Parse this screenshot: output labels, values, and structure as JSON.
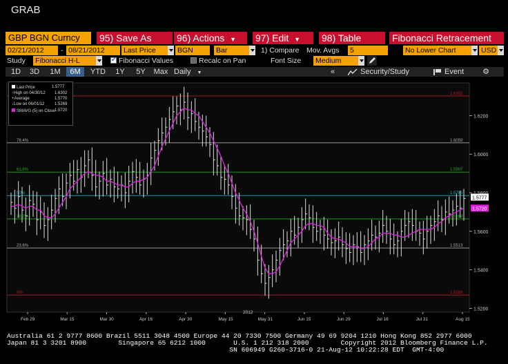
{
  "window": {
    "title": "GRAB"
  },
  "toolbar": {
    "security": "GBP BGN Curncy",
    "save_as": "95) Save As",
    "actions": "96) Actions",
    "edit": "97) Edit",
    "table": "98) Table",
    "study_title": "Fibonacci Retracement"
  },
  "params": {
    "start_date": "02/21/2012",
    "dash": "-",
    "end_date": "08/21/2012",
    "field": "Last Price",
    "source": "BGN",
    "chart_style": "Bar",
    "compare": "1) Compare",
    "mov_avgs_label": "Mov. Avgs",
    "mov_avgs_value": "5",
    "lower_chart": "No Lower Chart",
    "currency": "USD"
  },
  "study_row": {
    "study_label": "Study",
    "study_value": "Fibonacci H-L",
    "fib_values": "Fibonacci Values",
    "recalc": "Recalc on Pan",
    "font_size_label": "Font Size",
    "font_size_value": "Medium"
  },
  "tabs": {
    "items": [
      "1D",
      "3D",
      "1M",
      "6M",
      "YTD",
      "1Y",
      "5Y",
      "Max",
      "Daily"
    ],
    "active": "6M",
    "security_study": "Security/Study",
    "event": "Event"
  },
  "legend": {
    "last_price": "Last Price",
    "high": "High on 04/30/12",
    "high_val": "1.6302",
    "average": "Average",
    "average_val": "1.5770",
    "low": "Low on 06/01/12",
    "low_val": "1.5269",
    "last_val": "1.5777",
    "smavg": "SMAVG (5) on Close",
    "smavg_val": "1.5720"
  },
  "chart_data": {
    "type": "bar",
    "x_labels": [
      "Feb 29",
      "Mar 15",
      "Mar 30",
      "Apr 16",
      "Apr 30",
      "May 15",
      "May 31",
      "Jun 15",
      "Jun 29",
      "Jul 16",
      "Jul 31",
      "Aug 15"
    ],
    "year_label": "2012",
    "y_ticks": [
      "1.6200",
      "1.6000",
      "1.5800",
      "1.5600",
      "1.5400",
      "1.5200"
    ],
    "ylim": [
      1.518,
      1.637
    ],
    "fib_levels": [
      {
        "label": "100",
        "right_label": "1.6302",
        "value": 1.6302,
        "color": "#b02020"
      },
      {
        "label": "76.4%",
        "right_label": "1.6059",
        "value": 1.6059,
        "color": "#aaaaaa"
      },
      {
        "label": "61.8%",
        "right_label": "1.5907",
        "value": 1.5907,
        "color": "#22aa22"
      },
      {
        "label": "50%",
        "right_label": "1.5785",
        "value": 1.5785,
        "color": "#20b0c0"
      },
      {
        "label": "38.2%",
        "right_label": "1.5664",
        "value": 1.5664,
        "color": "#22aa22"
      },
      {
        "label": "23.6%",
        "right_label": "1.5513",
        "value": 1.5513,
        "color": "#aaaaaa"
      },
      {
        "label": "0%",
        "right_label": "1.5269",
        "value": 1.5269,
        "color": "#b02020"
      }
    ],
    "last_price_tag": "1.5777",
    "smavg_tag": "1.5720",
    "close": [
      1.575,
      1.572,
      1.578,
      1.571,
      1.568,
      1.576,
      1.574,
      1.566,
      1.57,
      1.563,
      1.566,
      1.571,
      1.577,
      1.582,
      1.578,
      1.585,
      1.589,
      1.586,
      1.592,
      1.588,
      1.594,
      1.597,
      1.589,
      1.583,
      1.586,
      1.59,
      1.584,
      1.587,
      1.583,
      1.582,
      1.584,
      1.58,
      1.586,
      1.591,
      1.588,
      1.584,
      1.587,
      1.589,
      1.598,
      1.602,
      1.607,
      1.611,
      1.614,
      1.618,
      1.622,
      1.625,
      1.623,
      1.627,
      1.619,
      1.621,
      1.617,
      1.614,
      1.612,
      1.609,
      1.605,
      1.597,
      1.594,
      1.588,
      1.587,
      1.584,
      1.578,
      1.572,
      1.568,
      1.567,
      1.566,
      1.561,
      1.556,
      1.545,
      1.538,
      1.533,
      1.536,
      1.54,
      1.545,
      1.55,
      1.553,
      1.555,
      1.56,
      1.558,
      1.562,
      1.566,
      1.569,
      1.567,
      1.562,
      1.56,
      1.561,
      1.558,
      1.556,
      1.554,
      1.555,
      1.557,
      1.553,
      1.551,
      1.549,
      1.553,
      1.552,
      1.549,
      1.553,
      1.555,
      1.558,
      1.557,
      1.559,
      1.563,
      1.56,
      1.556,
      1.553,
      1.555,
      1.56,
      1.563,
      1.565,
      1.563,
      1.56,
      1.559,
      1.556,
      1.56,
      1.563,
      1.565,
      1.568,
      1.566,
      1.57,
      1.569,
      1.571,
      1.573,
      1.572,
      1.577
    ],
    "smavg": [
      1.573,
      1.573,
      1.574,
      1.573,
      1.572,
      1.573,
      1.573,
      1.571,
      1.571,
      1.568,
      1.567,
      1.567,
      1.569,
      1.572,
      1.575,
      1.578,
      1.582,
      1.584,
      1.586,
      1.588,
      1.59,
      1.591,
      1.59,
      1.589,
      1.589,
      1.588,
      1.586,
      1.586,
      1.585,
      1.584,
      1.584,
      1.583,
      1.583,
      1.585,
      1.586,
      1.586,
      1.587,
      1.588,
      1.591,
      1.594,
      1.599,
      1.604,
      1.608,
      1.612,
      1.616,
      1.62,
      1.622,
      1.624,
      1.623,
      1.623,
      1.621,
      1.62,
      1.617,
      1.614,
      1.611,
      1.607,
      1.603,
      1.599,
      1.594,
      1.59,
      1.585,
      1.58,
      1.576,
      1.572,
      1.569,
      1.565,
      1.56,
      1.554,
      1.547,
      1.541,
      1.538,
      1.538,
      1.539,
      1.542,
      1.546,
      1.55,
      1.554,
      1.556,
      1.558,
      1.56,
      1.563,
      1.564,
      1.564,
      1.563,
      1.563,
      1.562,
      1.559,
      1.557,
      1.556,
      1.556,
      1.555,
      1.554,
      1.552,
      1.552,
      1.552,
      1.551,
      1.551,
      1.552,
      1.554,
      1.556,
      1.557,
      1.559,
      1.559,
      1.559,
      1.558,
      1.558,
      1.557,
      1.557,
      1.558,
      1.559,
      1.56,
      1.561,
      1.561,
      1.561,
      1.561,
      1.562,
      1.564,
      1.565,
      1.567,
      1.568,
      1.569,
      1.57,
      1.571,
      1.572
    ]
  },
  "footer": {
    "line1": "Australia 61 2 9777 8600 Brazil 5511 3048 4500 Europe 44 20 7330 7500 Germany 49 69 9204 1210 Hong Kong 852 2977 6000",
    "line2": "Japan 81 3 3201 8900        Singapore 65 6212 1000       U.S. 1 212 318 2000        Copyright 2012 Bloomberg Finance L.P.",
    "line3": "                                                        SN 606949 G260-3716-0 21-Aug-12 10:22:28 EDT  GMT-4:00"
  },
  "colors": {
    "bloomberg_red": "#c8102e",
    "amber": "#f5a100",
    "smavg": "#e020e0",
    "bars": "#e0e0e0"
  }
}
